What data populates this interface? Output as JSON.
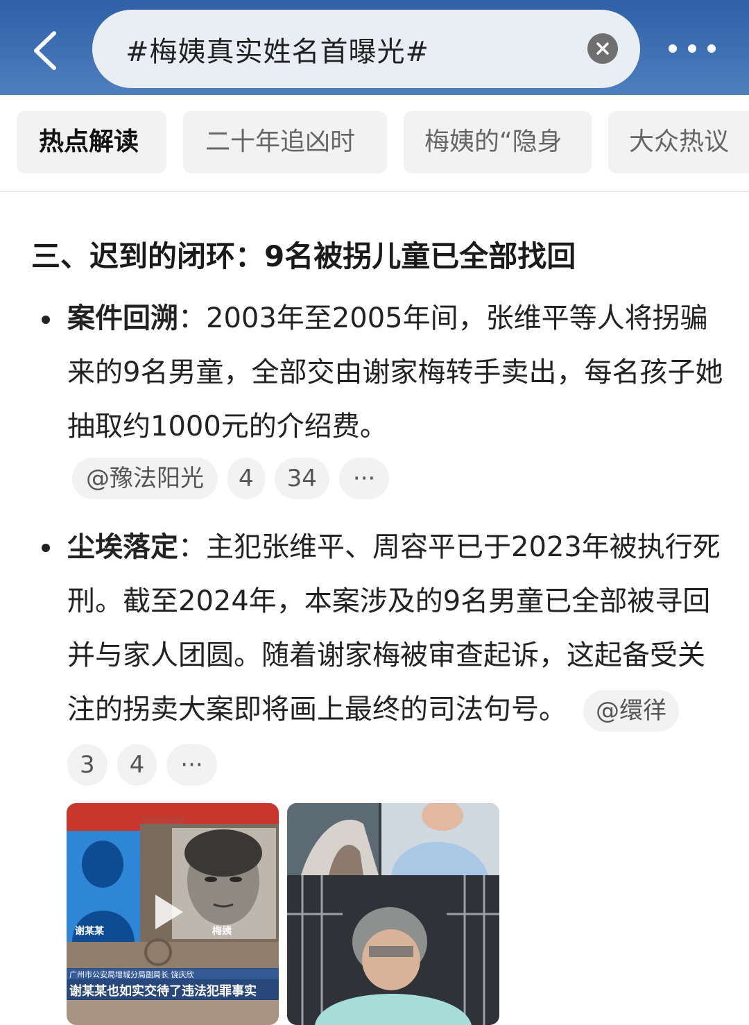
{
  "header": {
    "search_query": "#梅姨真实姓名首曝光#"
  },
  "tabs": [
    {
      "label": "热点解读",
      "active": true
    },
    {
      "label": "二十年追凶时",
      "active": false
    },
    {
      "label": "梅姨的“隐身",
      "active": false
    },
    {
      "label": "大众热议",
      "active": false
    }
  ],
  "article": {
    "heading": "三、迟到的闭环：9名被拐儿童已全部找回",
    "items": [
      {
        "title": "案件回溯",
        "sep": "：",
        "text": "2003年至2005年间，张维平等人将拐骗来的9名男童，全部交由谢家梅转手卖出，每名孩子她抽取约1000元的介绍费。",
        "source": "@豫法阳光",
        "count_a": "4",
        "count_b": "34",
        "more": "···"
      },
      {
        "title": "尘埃落定",
        "sep": "：",
        "text": "主犯张维平、周容平已于2023年被执行死刑。截至2024年，本案涉及的9名男童已全部被寻回并与家人团圆。随着谢家梅被审查起诉，这起备受关注的拐卖大案即将画上最终的司法句号。",
        "source": "@缳徉",
        "count_a": "3",
        "count_b": "4",
        "more": "···"
      }
    ]
  },
  "media": {
    "video": {
      "left_label": "谢某某",
      "right_label": "梅姨",
      "speaker_caption": "广州市公安局增城分局副局长 饶庆欣",
      "subtitle": "谢某某也如实交待了违法犯罪事实"
    }
  },
  "colors": {
    "header_bg": "#3b6cb1",
    "chip_bg": "#f2f2f2",
    "text": "#222222"
  }
}
